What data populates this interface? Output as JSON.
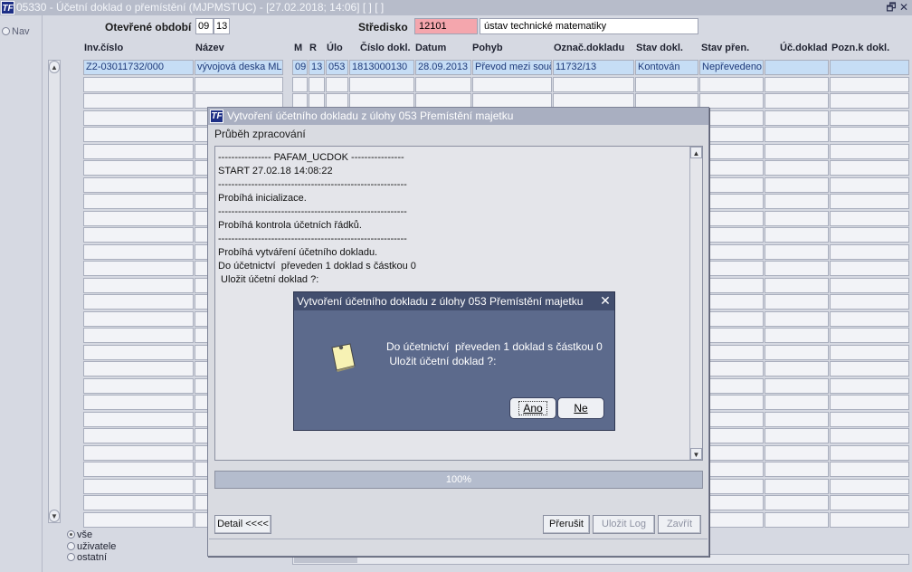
{
  "window": {
    "logo": "TF",
    "title": "05330 - Účetní doklad o přemístění (MJPMSTUC) - [27.02.2018; 14:06]  [ ]  [ ]",
    "restore_icon": "restore-icon",
    "close_icon": "close-icon"
  },
  "nav": {
    "label": "Nav"
  },
  "header": {
    "period_label": "Otevřené období",
    "period_month": "09",
    "period_year": "13",
    "center_label": "Středisko",
    "center_code": "12101",
    "center_name": "ústav technické matematiky"
  },
  "columns": [
    "Inv.číslo",
    "Název",
    "M",
    "R",
    "Úlo",
    "Číslo dokl.",
    "Datum",
    "Pohyb",
    "Označ.dokladu",
    "Stav dokl.",
    "Stav přen.",
    "Úč.doklad",
    "Pozn.k dokl."
  ],
  "row1": {
    "inv": "Z2-03011732/000",
    "name": "vývojová deska ML",
    "m": "09",
    "r": "13",
    "ulo": "053",
    "doc": "1813000130",
    "date": "28.09.2013",
    "move": "Převod mezi souč",
    "mark": "11732/13",
    "state": "Kontován",
    "transfer": "Nepřevedeno",
    "ucdoc": "",
    "note": ""
  },
  "filter": {
    "opt1": "vše",
    "opt2": "uživatele",
    "opt3": "ostatní"
  },
  "process_dialog": {
    "logo": "TF",
    "title": "Vytvoření účetního dokladu z úlohy 053 Přemístění majetku",
    "subtitle": "Průběh zpracování",
    "log": "---------------- PAFAM_UCDOK ----------------\nSTART 27.02.18 14:08:22\n---------------------------------------------------------\nProbíhá inicializace.\n---------------------------------------------------------\nProbíhá kontrola účetních řádků.\n---------------------------------------------------------\nProbíhá vytváření účetního dokladu.\nDo účetnictví  převeden 1 doklad s částkou 0\n Uložit účetní doklad ?:",
    "progress": "100%",
    "progress_value": 1.0,
    "detail_btn": "Detail <<<<",
    "stop_btn": "Přerušit",
    "savelog_btn": "Uložit Log",
    "close_btn": "Zavřít"
  },
  "confirm": {
    "title": "Vytvoření účetního dokladu z úlohy 053 Přemístění majetku",
    "message": "Do účetnictví  převeden 1 doklad s částkou 0\n Uložit účetní doklad ?:",
    "yes": "Ano",
    "no": "Ne",
    "icon": "note-icon"
  }
}
